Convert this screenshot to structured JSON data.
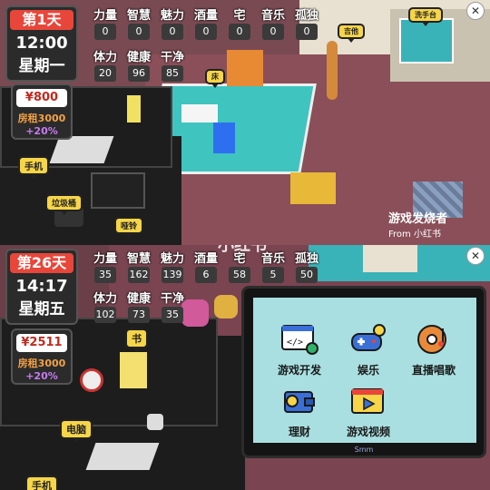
{
  "top": {
    "date": {
      "day": "第1天",
      "time": "12:00",
      "weekday": "星期一"
    },
    "stats_row1": [
      {
        "label": "力量",
        "value": "0"
      },
      {
        "label": "智慧",
        "value": "0"
      },
      {
        "label": "魅力",
        "value": "0"
      },
      {
        "label": "酒量",
        "value": "0"
      },
      {
        "label": "宅",
        "value": "0"
      },
      {
        "label": "音乐",
        "value": "0"
      },
      {
        "label": "孤独",
        "value": "0"
      }
    ],
    "stats_row2": [
      {
        "label": "体力",
        "value": "20"
      },
      {
        "label": "健康",
        "value": "96"
      },
      {
        "label": "干净",
        "value": "85"
      }
    ],
    "money": {
      "value": "¥800",
      "rent": "房租3000",
      "rent_pct": "+20%"
    },
    "tags": {
      "phone": "手机",
      "trash": "垃圾桶",
      "dumbbell": "哑铃",
      "bed": "床",
      "guitar": "吉他",
      "washbasin": "洗手台"
    },
    "watermark": {
      "brand": "游戏发烧者",
      "from": "From 小红书"
    }
  },
  "bottom": {
    "date": {
      "day": "第26天",
      "time": "14:17",
      "weekday": "星期五"
    },
    "stats_row1": [
      {
        "label": "力量",
        "value": "35"
      },
      {
        "label": "智慧",
        "value": "162"
      },
      {
        "label": "魅力",
        "value": "139"
      },
      {
        "label": "酒量",
        "value": "6"
      },
      {
        "label": "宅",
        "value": "58"
      },
      {
        "label": "音乐",
        "value": "5"
      },
      {
        "label": "孤独",
        "value": "50"
      }
    ],
    "stats_row2": [
      {
        "label": "体力",
        "value": "102"
      },
      {
        "label": "健康",
        "value": "73"
      },
      {
        "label": "干净",
        "value": "35"
      }
    ],
    "money": {
      "value": "¥2511",
      "rent": "房租3000",
      "rent_pct": "+20%"
    },
    "tags": {
      "book": "书",
      "computer": "电脑",
      "phone": "手机"
    },
    "watermark": {
      "brand": "小红书"
    },
    "computer_apps": [
      {
        "label": "游戏开发",
        "icon": "code-gear-icon"
      },
      {
        "label": "娱乐",
        "icon": "gamepad-icon"
      },
      {
        "label": "直播唱歌",
        "icon": "music-disc-icon"
      },
      {
        "label": "理财",
        "icon": "wallet-icon"
      },
      {
        "label": "游戏视频",
        "icon": "video-play-icon"
      }
    ],
    "monitor_brand": "Smm"
  },
  "colors": {
    "accent_red": "#e8463a",
    "tag_yellow": "#f6d548",
    "screen_bg": "#a9dfe0",
    "rent_orange": "#f3a244",
    "rent_purple": "#c77bf0"
  }
}
